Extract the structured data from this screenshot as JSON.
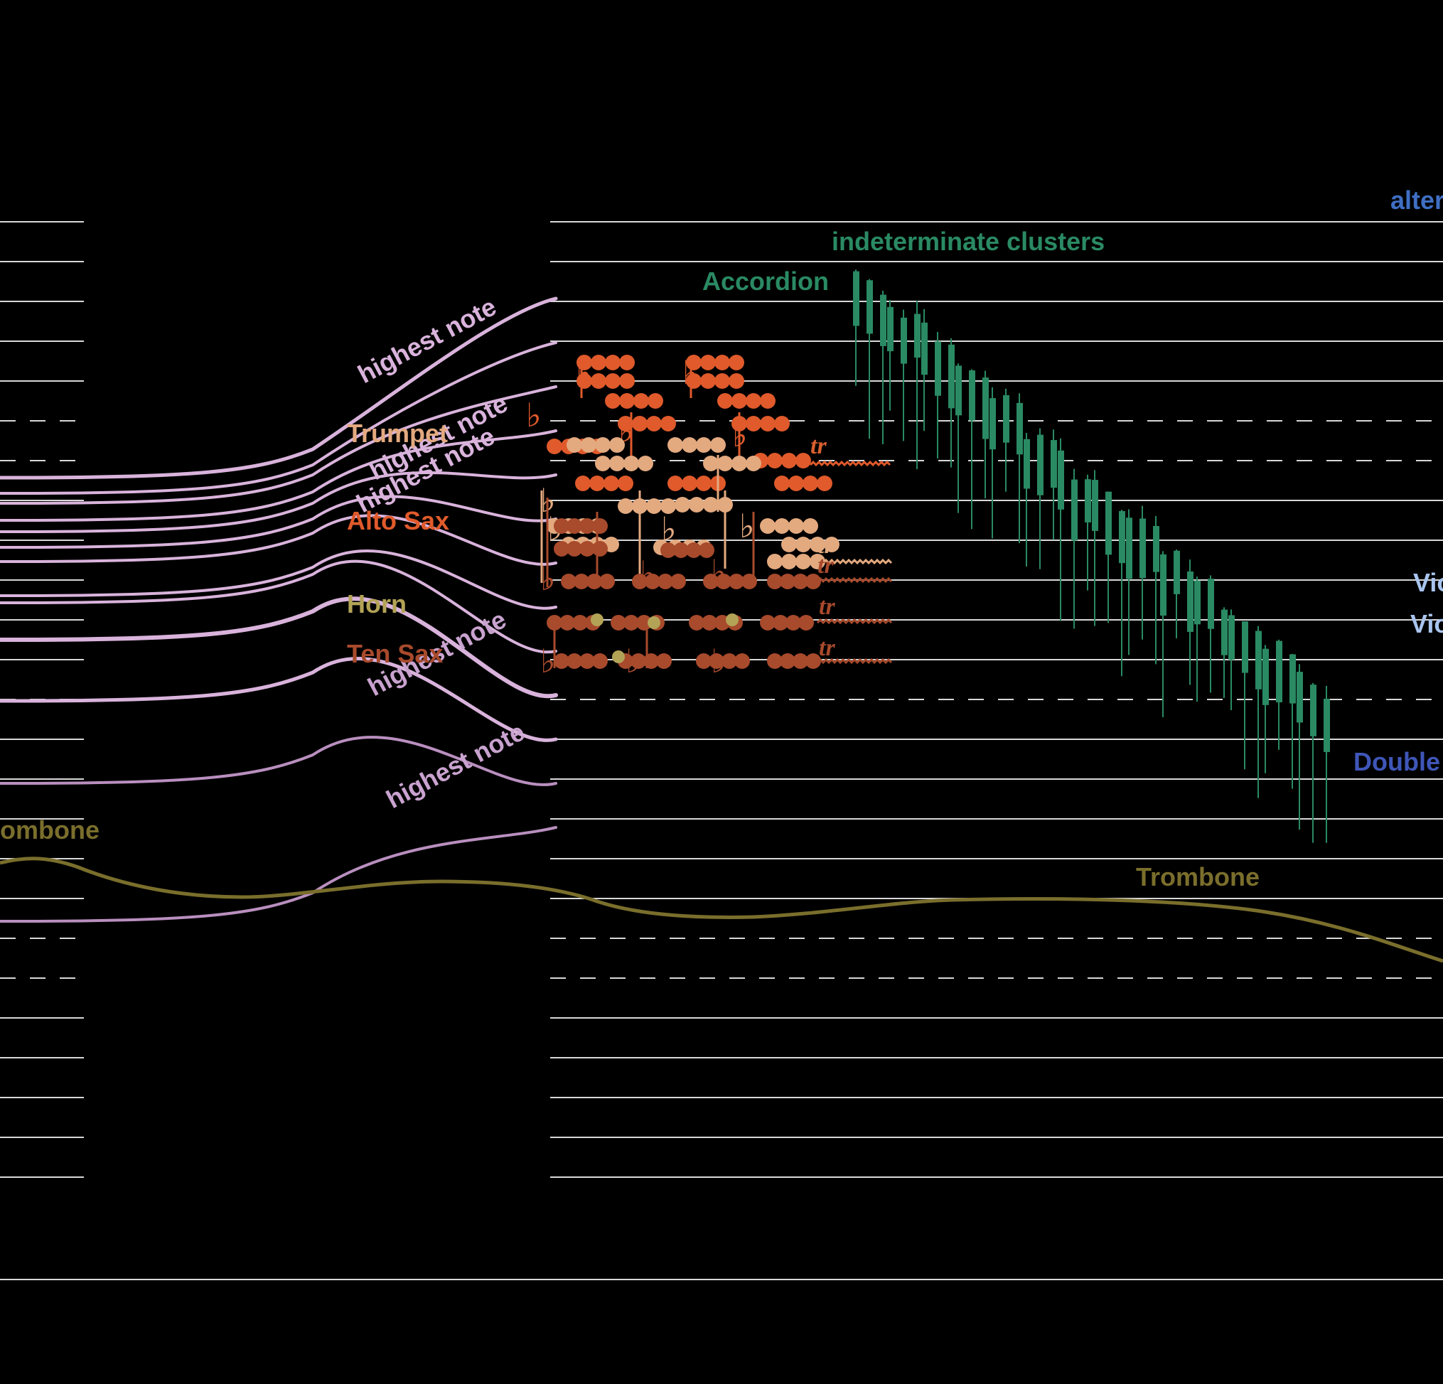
{
  "colors": {
    "background": "#000000",
    "staff_line": "#d8d8d8",
    "strings_glissando": "#d9b3dc",
    "strings_glissando_dim": "#b98fbf",
    "trumpet": "#e3a97f",
    "alto_sax": "#e05a2b",
    "horn": "#b3a356",
    "ten_sax": "#a84a2c",
    "trombone": "#7a6e2c",
    "accordion": "#2a8a63",
    "violin": "#a8c4ee",
    "double_bass": "#3f56b8",
    "alternate": "#3f6fc4"
  },
  "labels": {
    "highest_note_1": "highest note",
    "highest_note_2": "highest note",
    "highest_note_3": "highest note",
    "highest_note_4": "highest note",
    "highest_note_5": "highest note",
    "trumpet": "Trumpet",
    "alto_sax": "Alto Sax",
    "horn": "Horn",
    "ten_sax": "Ten Sax",
    "trombone_left": "ombone",
    "trombone_right": "Trombone",
    "accordion": "Accordion",
    "indeterminate_clusters": "indeterminate clusters",
    "alternate": "alter",
    "violin_1": "Vio",
    "violin_2": "Vio",
    "double_bass": "Double"
  },
  "trill_marks": [
    "tr",
    "tr",
    "tr",
    "tr",
    "tr"
  ],
  "icons": {
    "flat": "flat-accidental-icon",
    "notehead": "notehead-icon",
    "trill": "trill-wavy-line-icon",
    "cluster": "cluster-bar-icon"
  }
}
